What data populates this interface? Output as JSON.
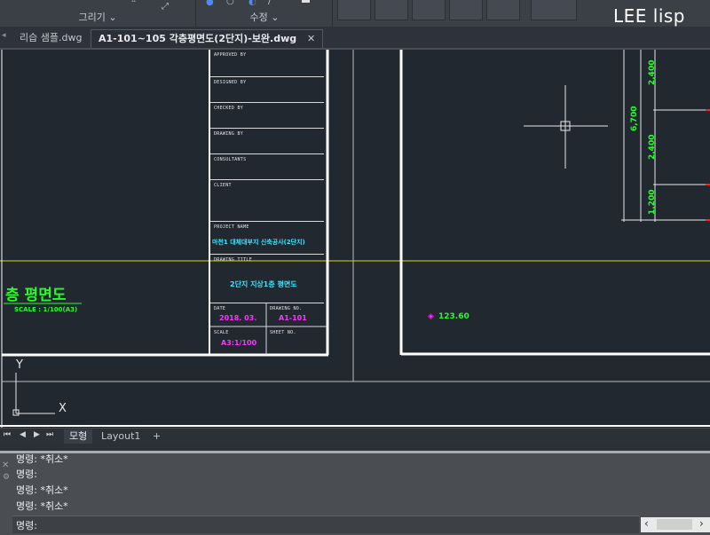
{
  "ribbon": {
    "group_draw_label": "그리기",
    "group_modify_label": "수정",
    "brand": "LEE lisp"
  },
  "tabs": [
    {
      "label": "리습 샘플.dwg"
    },
    {
      "label": "A1-101~105 각층평면도(2단지)-보완.dwg"
    }
  ],
  "drawing": {
    "title_block": {
      "approved_by": "APPROVED BY",
      "designed_by": "DESIGNED BY",
      "checked_by": "CHECKED BY",
      "drawing_by": "DRAWING BY",
      "consultants": "CONSULTANTS",
      "client": "CLIENT",
      "project_name_label": "PROJECT NAME",
      "project_name": "마천1 대체대부지 신축공사(2단지)",
      "drawing_title_label": "DRAWING TITLE",
      "drawing_title": "2단지 지상1층 평면도",
      "date_label": "DATE",
      "date_value": "2018. 03.",
      "drawing_no_label": "DRAWING NO.",
      "drawing_no_value": "A1-101",
      "scale_label": "SCALE",
      "scale_value": "A3:1/100",
      "sheet_no_label": "SHEET NO."
    },
    "plan_title": "층 평면도",
    "plan_scale": "SCALE : 1/100(A3)",
    "level_mark": "123.60",
    "dimensions": [
      "2,400",
      "6,700",
      "2,400",
      "1,200"
    ],
    "ucs_x": "X",
    "ucs_y": "Y"
  },
  "layout_tabs": [
    {
      "label": "모형"
    },
    {
      "label": "Layout1"
    },
    {
      "label": "+"
    }
  ],
  "command": {
    "history": [
      "명령: *취소*",
      "명령:",
      "명령: *취소*",
      "명령: *취소*"
    ],
    "prompt": "명령:"
  }
}
